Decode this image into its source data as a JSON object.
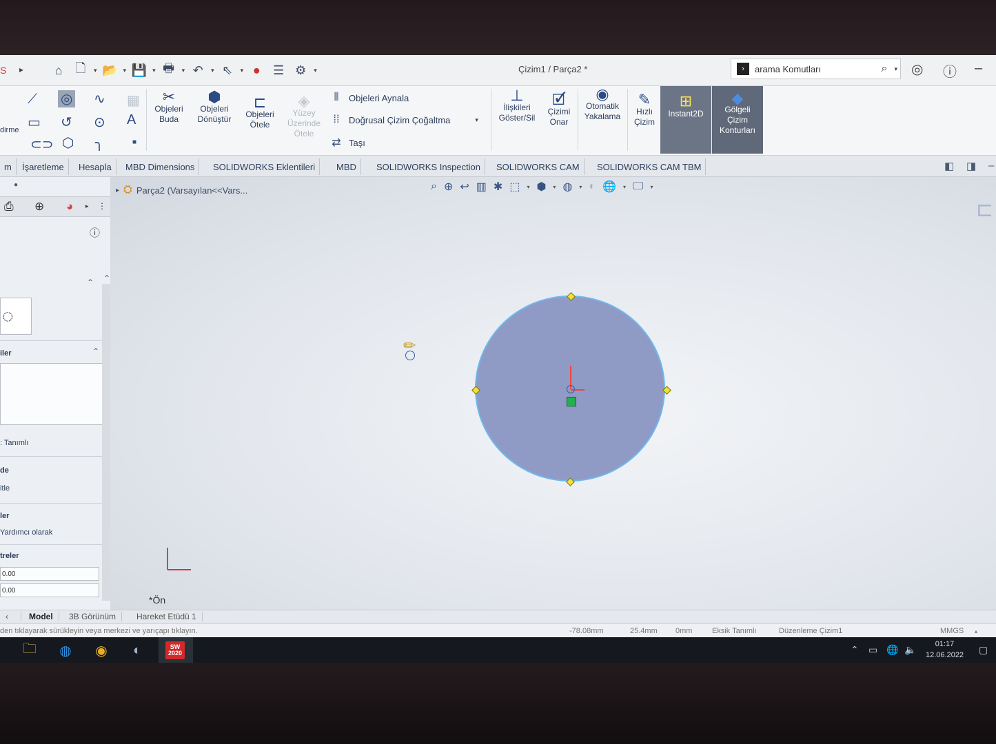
{
  "titlebar": {
    "doc_title": "Çizim1 / Parça2 *",
    "search_placeholder": "arama Komutları",
    "left_fragment": "S"
  },
  "ribbon": {
    "side_label": "dirme",
    "buttons": {
      "trim": "Objeleri\nBuda",
      "convert": "Objeleri\nDönüştür",
      "offset": "Objeleri\nÖtele",
      "surface_offset": "Yüzey\nÜzerinde\nÖtele",
      "relations": "İlişkileri\nGöster/Sil",
      "repair": "Çizimi\nOnar",
      "snap": "Otomatik\nYakalama",
      "rapid": "Hızlı\nÇizim",
      "instant2d": "Instant2D",
      "shaded": "Gölgeli\nÇizim\nKonturları"
    },
    "rows": {
      "mirror": "Objeleri Aynala",
      "pattern": "Doğrusal Çizim Çoğaltma",
      "move": "Taşı"
    }
  },
  "tabs": {
    "items": [
      "m",
      "İşaretleme",
      "Hesapla",
      "MBD Dimensions",
      "SOLIDWORKS Eklentileri",
      "MBD",
      "SOLIDWORKS Inspection",
      "SOLIDWORKS CAM",
      "SOLIDWORKS CAM TBM"
    ]
  },
  "leftpanel": {
    "sec_entities": "iler",
    "definition": ": Tanımlı",
    "sec_options": "de",
    "options_item": "itle",
    "sec_params": "ler",
    "construction": "Yardımcı olarak",
    "sec_params2": "treler",
    "param1": "0.00",
    "param2": "0.00"
  },
  "viewport": {
    "breadcrumb": "Parça2  (Varsayılan<<Vars...",
    "view_label": "*Ön"
  },
  "bottom_tabs": [
    "Model",
    "3B Görünüm",
    "Hareket Etüdü 1"
  ],
  "status": {
    "hint": "den tıklayarak sürükleyin veya merkezi ve yarıçapı tıklayın.",
    "x": "-78.08mm",
    "y": "25.4mm",
    "z": "0mm",
    "state": "Eksik Tanımlı",
    "mode": "Düzenleme Çizim1",
    "units": "MMGS"
  },
  "taskbar": {
    "sw_label": "SW\n2020",
    "time": "01:17",
    "date": "12.06.2022"
  },
  "colors": {
    "circle_fill": "#8f9bc4",
    "circle_stroke": "#6fb8ee",
    "handle": "#f1e03b",
    "ribbon_active": "#6b7585"
  }
}
